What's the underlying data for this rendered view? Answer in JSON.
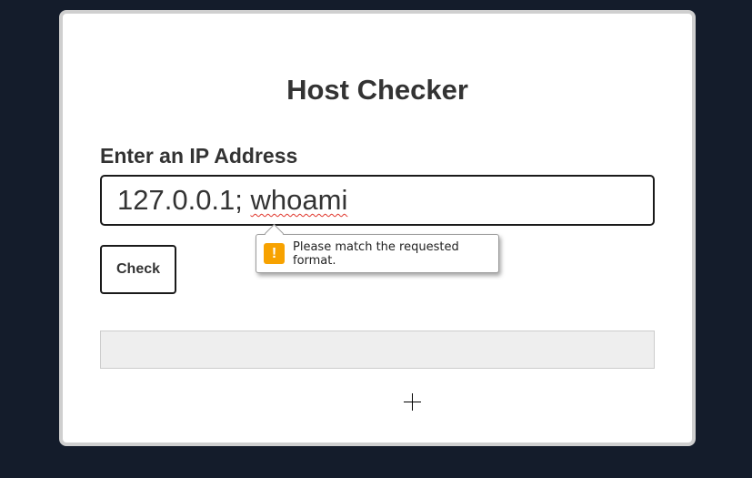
{
  "page": {
    "title": "Host Checker"
  },
  "form": {
    "ip_label": "Enter an IP Address",
    "ip_value_plain": "127.0.0.1; ",
    "ip_value_flagged": "whoami",
    "check_label": "Check"
  },
  "validation": {
    "message": "Please match the requested format.",
    "icon": "warning-icon",
    "icon_glyph": "!",
    "icon_color": "#f7a200"
  },
  "result": {
    "text": ""
  },
  "colors": {
    "background": "#141c2b",
    "card": "#ffffff",
    "result_bg": "#eeeeee"
  }
}
